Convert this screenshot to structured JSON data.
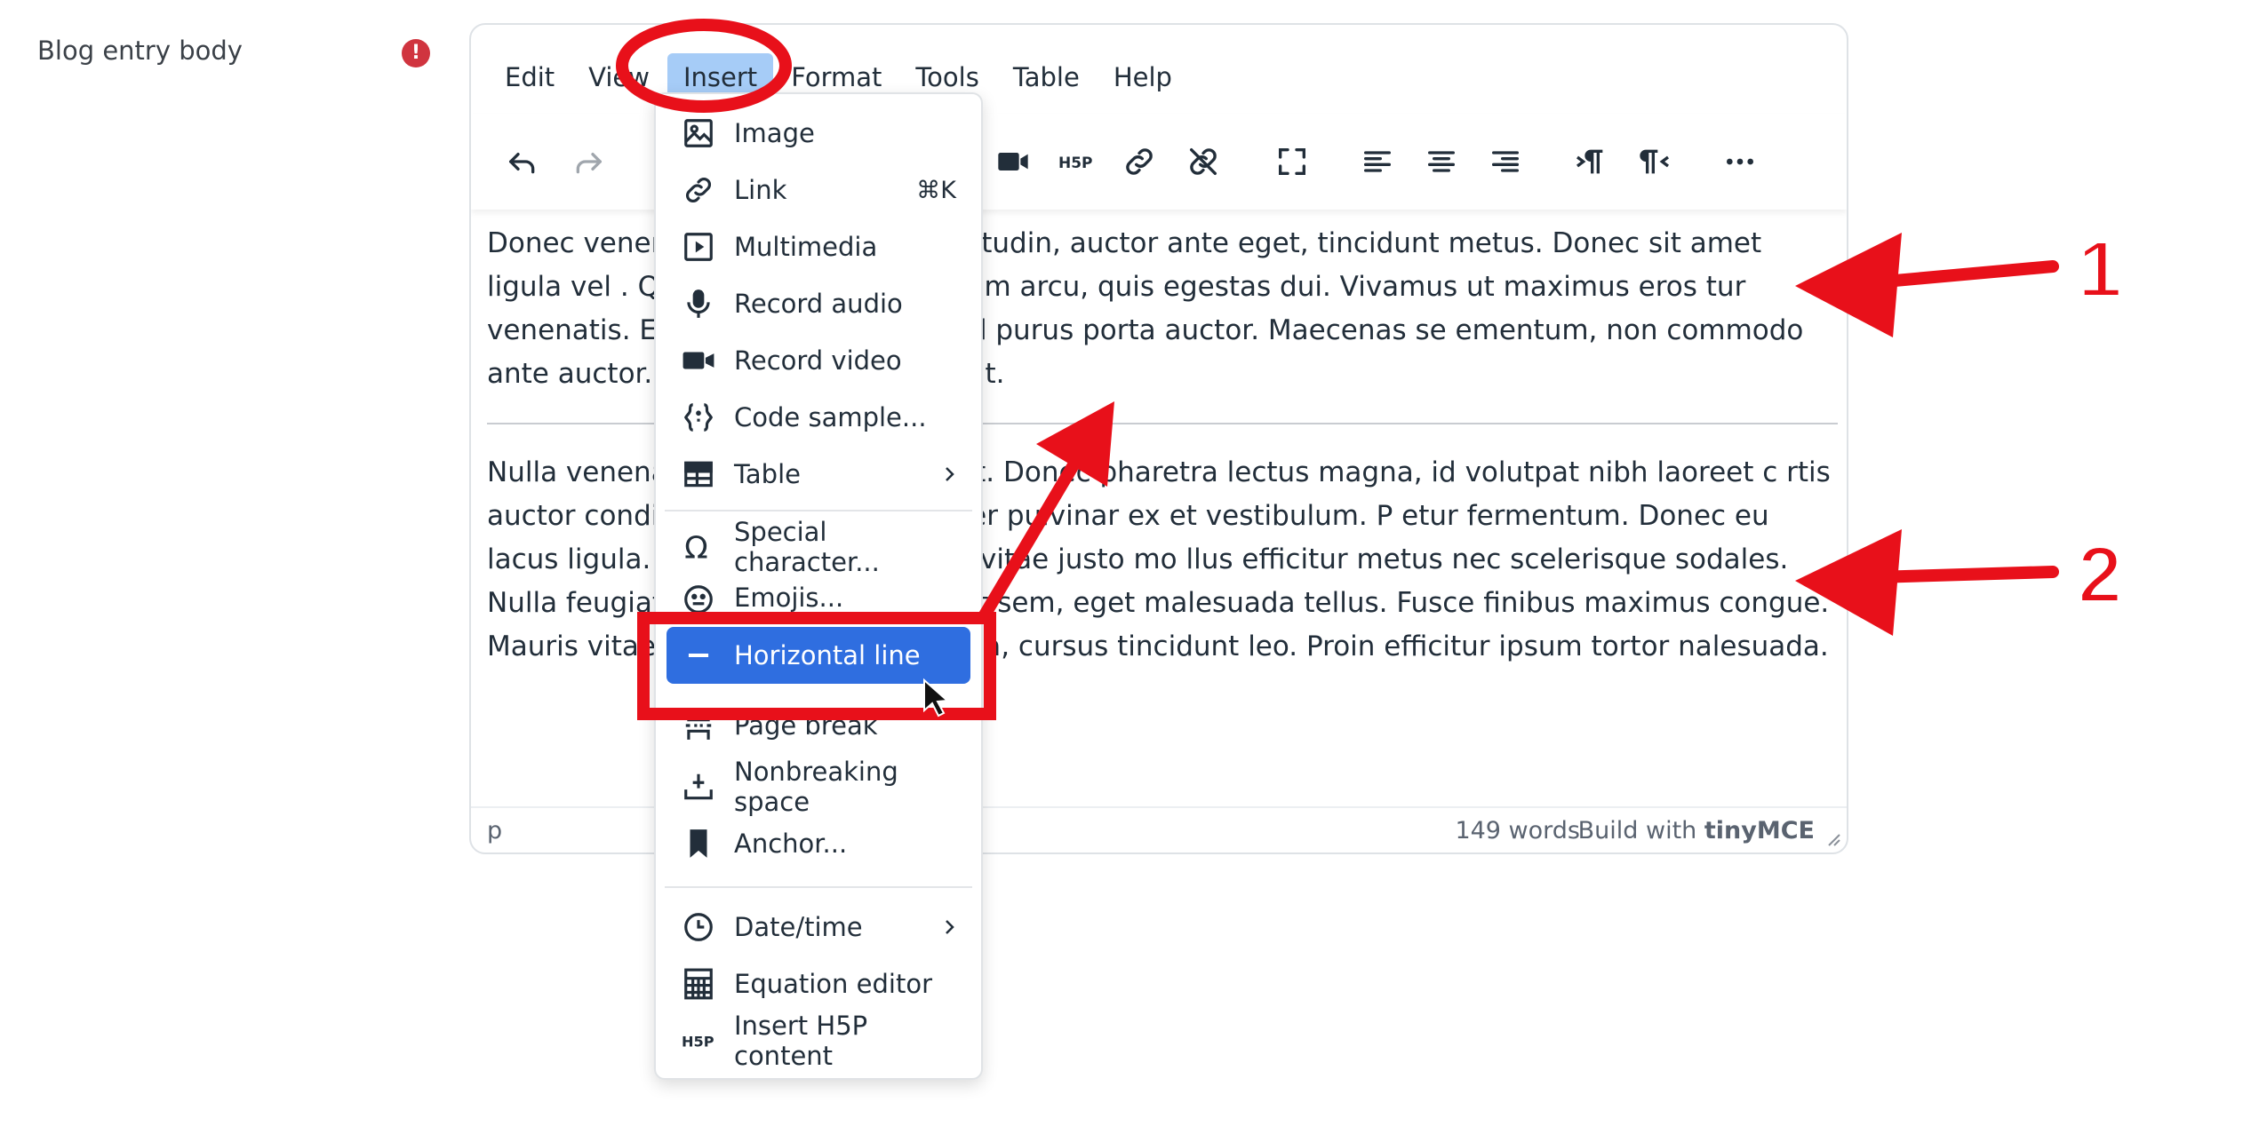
{
  "field": {
    "label": "Blog entry body",
    "error_icon": "!"
  },
  "menubar": [
    "Edit",
    "View",
    "Insert",
    "Format",
    "Tools",
    "Table",
    "Help"
  ],
  "menubar_active": "Insert",
  "toolbar_icons": [
    "undo-icon",
    "redo-icon",
    "video-icon",
    "h5p-icon",
    "link-icon",
    "unlink-icon",
    "fullscreen-icon",
    "align-left-icon",
    "align-center-icon",
    "align-right-icon",
    "ltr-icon",
    "rtl-icon",
    "more-icon"
  ],
  "content": {
    "p1": "Donec venenatis nulla id eros sollicitudin, auctor ante eget, tincidunt metus. Donec sit amet ligula vel . Quisque non condimentum arcu, quis egestas dui. Vivamus ut maximus eros tur venenatis. Etiam molestie tellus sed purus porta auctor. Maecenas se ementum, non commodo ante auctor. Curabitur ac mattis velit.",
    "p2": "Nulla venenat ante condimentum at. Donec pharetra lectus magna, id volutpat nibh laoreet c rtis auctor condimentum. Ut ullamcorper pulvinar ex et vestibulum. P etur fermentum. Donec eu lacus ligula. Morbi dignissim metus vitae justo mo llus efficitur metus nec scelerisque sodales. Nulla feugiat massa mauris orna eet sem, eget malesuada tellus. Fusce finibus maximus congue. Mauris vitae , luctus sed lacus lacinia, cursus tincidunt leo. Proin efficitur ipsum tortor nalesuada."
  },
  "statusbar": {
    "path": "p",
    "words": "149 words",
    "build": "Build with",
    "brand": "tinyMCE"
  },
  "insert_menu": [
    {
      "label": "Image",
      "icon": "image-icon"
    },
    {
      "label": "Link",
      "icon": "link-icon",
      "shortcut": "⌘K"
    },
    {
      "label": "Multimedia",
      "icon": "multimedia-icon"
    },
    {
      "label": "Record audio",
      "icon": "microphone-icon"
    },
    {
      "label": "Record video",
      "icon": "video-camera-icon"
    },
    {
      "label": "Code sample...",
      "icon": "code-sample-icon"
    },
    {
      "label": "Table",
      "icon": "table-icon",
      "submenu": true
    },
    {
      "label": "Special character...",
      "icon": "omega-icon"
    },
    {
      "label": "Emojis...",
      "icon": "emoji-icon"
    },
    {
      "label": "Horizontal line",
      "icon": "horizontal-line-icon",
      "selected": true
    },
    {
      "label": "Page break",
      "icon": "page-break-icon"
    },
    {
      "label": "Nonbreaking space",
      "icon": "nonbreaking-space-icon"
    },
    {
      "label": "Anchor...",
      "icon": "bookmark-icon"
    },
    {
      "label": "Date/time",
      "icon": "clock-icon",
      "submenu": true
    },
    {
      "label": "Equation editor",
      "icon": "calculator-icon"
    },
    {
      "label": "Insert H5P content",
      "icon": "h5p-icon"
    }
  ],
  "annotations": {
    "callout1": "1",
    "callout2": "2",
    "accent": "#e8101a"
  }
}
